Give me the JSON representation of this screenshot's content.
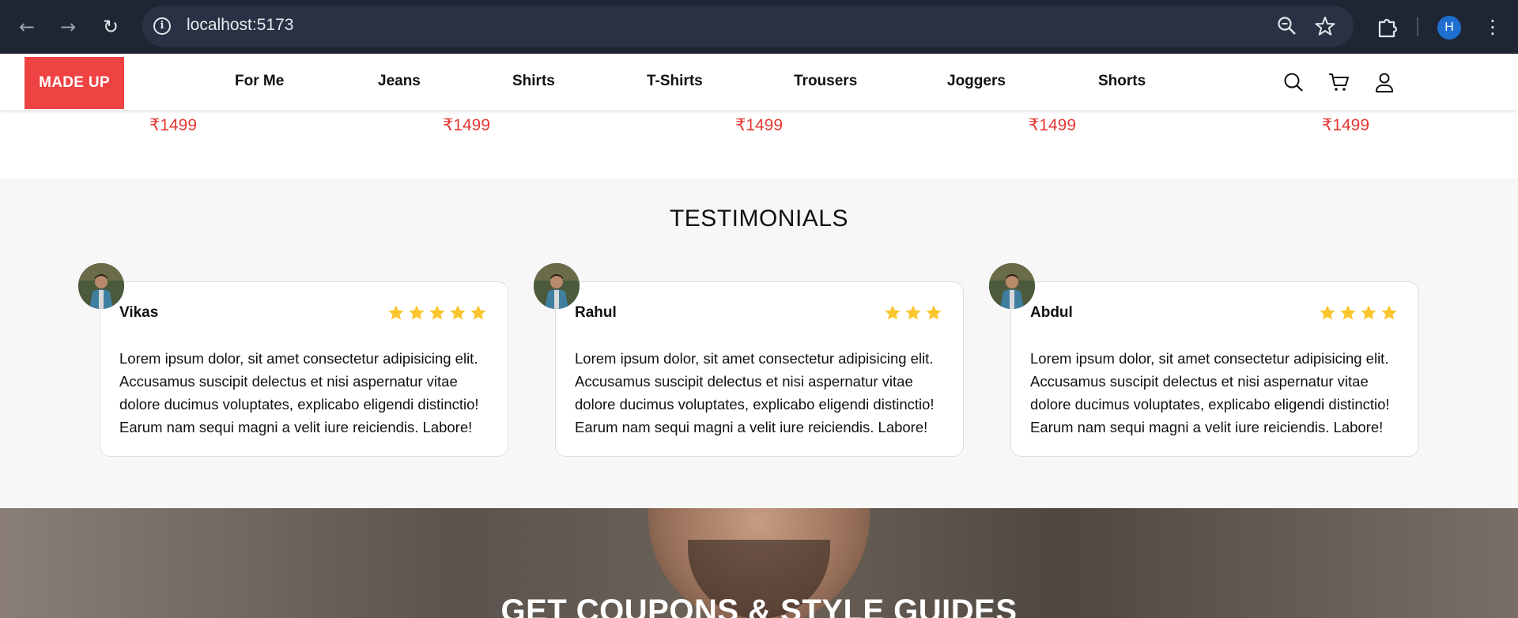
{
  "browser": {
    "url": "localhost:5173",
    "profile_initial": "H"
  },
  "header": {
    "logo": "MADE UP",
    "nav": [
      "For Me",
      "Jeans",
      "Shirts",
      "T-Shirts",
      "Trousers",
      "Joggers",
      "Shorts"
    ]
  },
  "products": {
    "prices": [
      "₹1499",
      "₹1499",
      "₹1499",
      "₹1499",
      "₹1499"
    ]
  },
  "testimonials": {
    "title": "TESTIMONIALS",
    "items": [
      {
        "name": "Vikas",
        "rating": 5,
        "text": "Lorem ipsum dolor, sit amet consectetur adipisicing elit. Accusamus suscipit delectus et nisi aspernatur vitae dolore ducimus voluptates, explicabo eligendi distinctio! Earum nam sequi magni a velit iure reiciendis. Labore!"
      },
      {
        "name": "Rahul",
        "rating": 3,
        "text": "Lorem ipsum dolor, sit amet consectetur adipisicing elit. Accusamus suscipit delectus et nisi aspernatur vitae dolore ducimus voluptates, explicabo eligendi distinctio! Earum nam sequi magni a velit iure reiciendis. Labore!"
      },
      {
        "name": "Abdul",
        "rating": 4,
        "text": "Lorem ipsum dolor, sit amet consectetur adipisicing elit. Accusamus suscipit delectus et nisi aspernatur vitae dolore ducimus voluptates, explicabo eligendi distinctio! Earum nam sequi magni a velit iure reiciendis. Labore!"
      }
    ]
  },
  "coupons": {
    "title": "GET COUPONS & STYLE GUIDES"
  },
  "colors": {
    "accent": "#ef4343",
    "price": "#e53935",
    "star": "#fbc52d"
  }
}
